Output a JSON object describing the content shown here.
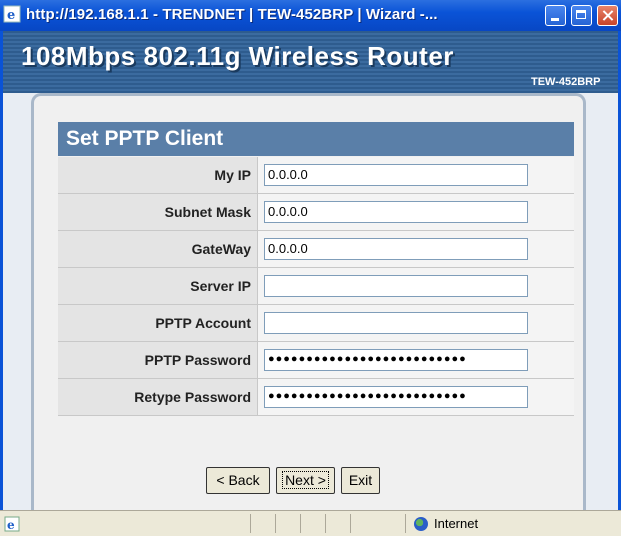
{
  "window": {
    "title": "http://192.168.1.1 - TRENDNET | TEW-452BRP | Wizard -..."
  },
  "header": {
    "product_title": "108Mbps 802.11g Wireless Router",
    "model": "TEW-452BRP"
  },
  "section": {
    "title": "Set PPTP Client"
  },
  "form": {
    "fields": [
      {
        "label": "My IP",
        "value": "0.0.0.0"
      },
      {
        "label": "Subnet Mask",
        "value": "0.0.0.0"
      },
      {
        "label": "GateWay",
        "value": "0.0.0.0"
      },
      {
        "label": "Server IP",
        "value": ""
      },
      {
        "label": "PPTP Account",
        "value": ""
      },
      {
        "label": "PPTP Password",
        "value": "●●●●●●●●●●●●●●●●●●●●●●●●●●"
      },
      {
        "label": "Retype Password",
        "value": "●●●●●●●●●●●●●●●●●●●●●●●●●●"
      }
    ]
  },
  "buttons": {
    "back": "< Back",
    "next": "Next >",
    "exit": "Exit"
  },
  "statusbar": {
    "zone": "Internet"
  }
}
